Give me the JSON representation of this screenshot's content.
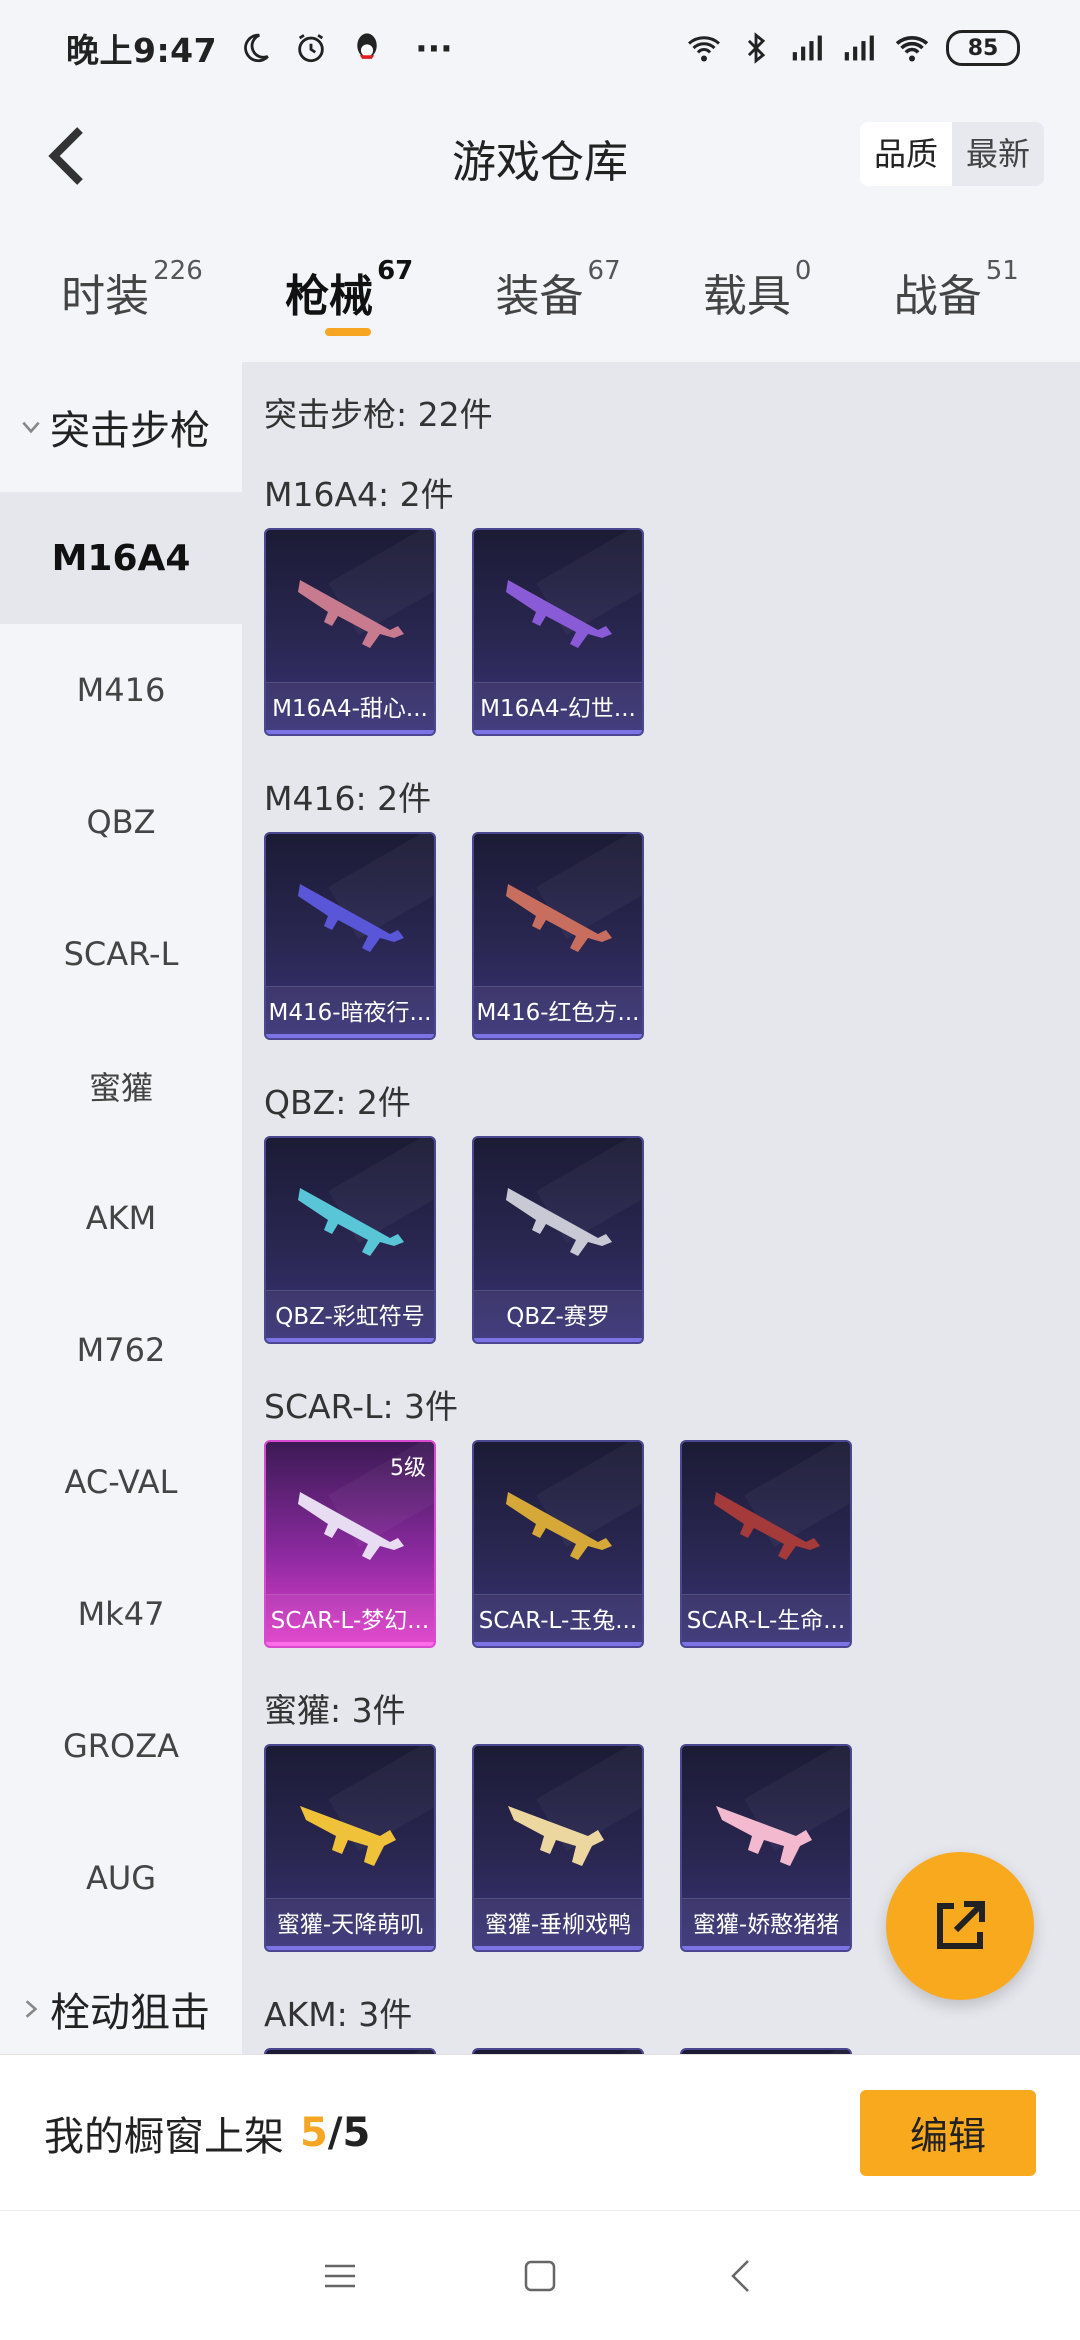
{
  "status": {
    "time": "晚上9:47",
    "more": "···",
    "battery": "85"
  },
  "header": {
    "title": "游戏仓库",
    "sort_options": [
      "品质",
      "最新"
    ]
  },
  "tabs": [
    {
      "label": "时装",
      "count": "226"
    },
    {
      "label": "枪械",
      "count": "67"
    },
    {
      "label": "装备",
      "count": "67"
    },
    {
      "label": "载具",
      "count": "0"
    },
    {
      "label": "战备",
      "count": "51"
    }
  ],
  "sidenav": {
    "group": "突击步枪",
    "items": [
      "M16A4",
      "M416",
      "QBZ",
      "SCAR-L",
      "蜜獾",
      "AKM",
      "M762",
      "AC-VAL",
      "Mk47",
      "GROZA",
      "AUG"
    ],
    "next_group": "栓动狙击"
  },
  "content": {
    "summary": "突击步枪: 22件",
    "sections": [
      {
        "title": "M16A4: 2件",
        "items": [
          "M16A4-甜心...",
          "M16A4-幻世..."
        ]
      },
      {
        "title": "M416: 2件",
        "items": [
          "M416-暗夜行...",
          "M416-红色方..."
        ]
      },
      {
        "title": "QBZ: 2件",
        "items": [
          "QBZ-彩虹符号",
          "QBZ-赛罗"
        ]
      },
      {
        "title": "SCAR-L: 3件",
        "items": [
          "SCAR-L-梦幻...",
          "SCAR-L-玉兔...",
          "SCAR-L-生命..."
        ],
        "level": "5级"
      },
      {
        "title": "蜜獾: 3件",
        "items": [
          "蜜獾-天降萌叽",
          "蜜獾-垂柳戏鸭",
          "蜜獾-娇憨猪猪"
        ]
      },
      {
        "title": "AKM: 3件"
      }
    ]
  },
  "showcase": {
    "label": "我的橱窗上架",
    "current": "5",
    "sep": "/",
    "total": "5",
    "edit": "编辑"
  },
  "colors": {
    "accent": "#f8a91e",
    "card": "#2a2752",
    "legendary": "#e23fcb"
  }
}
